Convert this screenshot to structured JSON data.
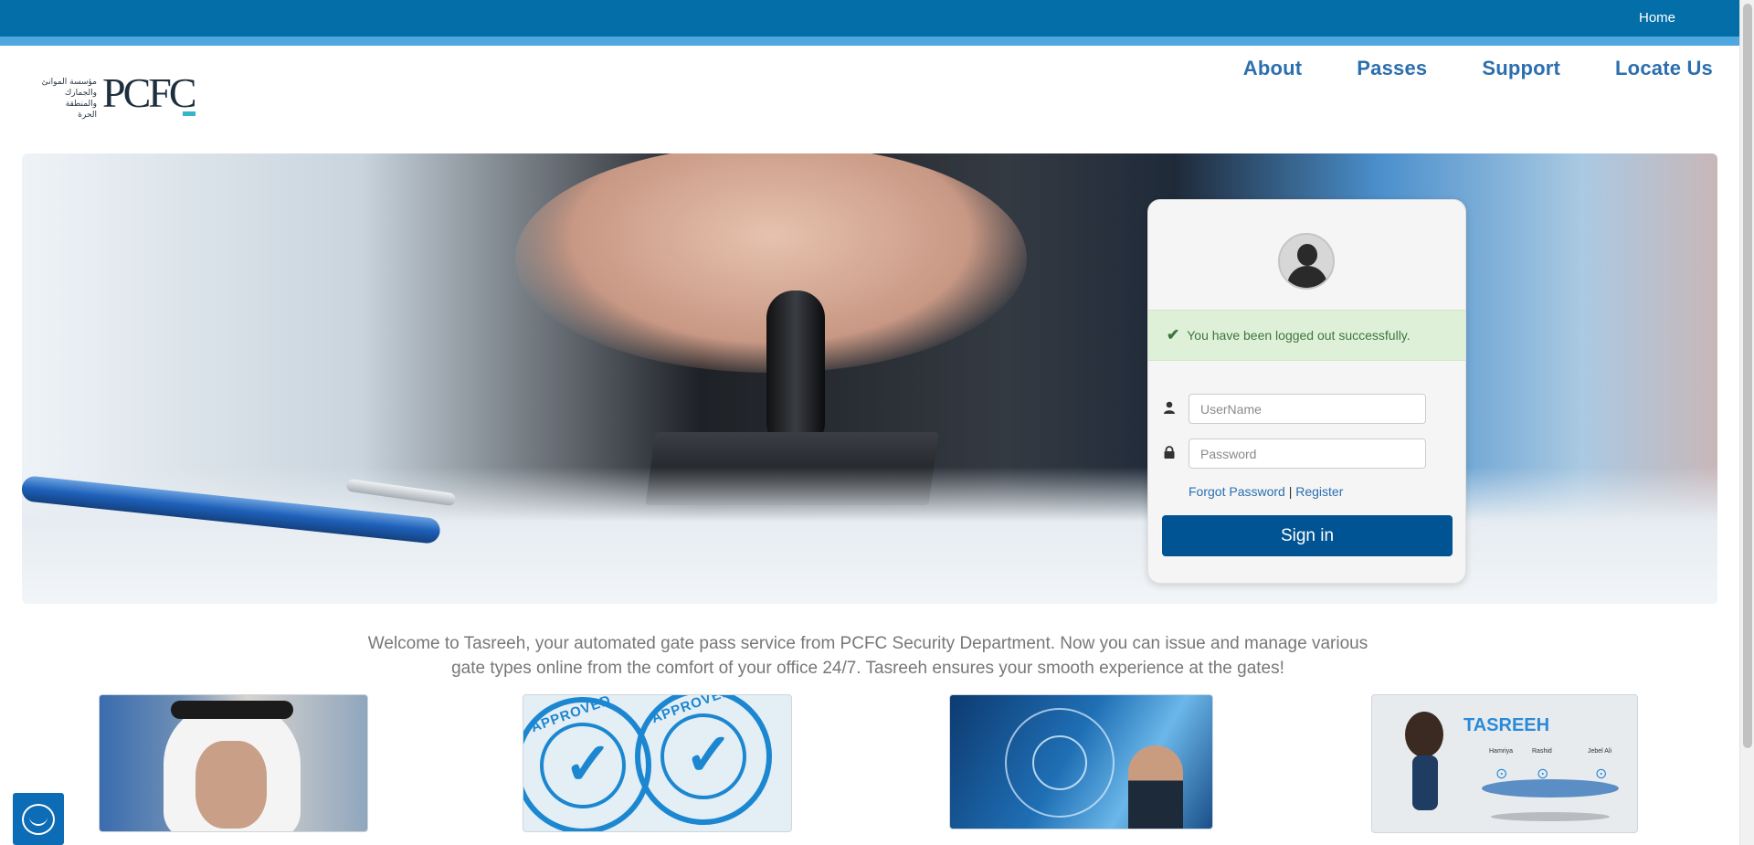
{
  "topbar": {
    "home_label": "Home"
  },
  "brand": {
    "logo_text": "PCFC",
    "logo_arabic_lines": [
      "مؤسسة الموانئ",
      "والجمارك والمنطقة",
      "الحرة"
    ]
  },
  "nav": {
    "items": [
      {
        "label": "About"
      },
      {
        "label": "Passes"
      },
      {
        "label": "Support"
      },
      {
        "label": "Locate Us"
      }
    ]
  },
  "login": {
    "alert_message": "You have been logged out successfully.",
    "username_placeholder": "UserName",
    "password_placeholder": "Password",
    "forgot_password_label": "Forgot Password",
    "separator": "|",
    "register_label": "Register",
    "signin_label": "Sign in"
  },
  "welcome": {
    "line1": "Welcome to Tasreeh, your automated gate pass service from PCFC Security Department. Now you can issue and manage various",
    "line2": "gate types online from the comfort of your office 24/7. Tasreeh ensures your smooth experience at the gates!"
  },
  "tiles": {
    "approved_word": "APPROVED",
    "tasreeh_label": "TASREEH",
    "places": [
      "Hamriya",
      "Rashid",
      "Jebel Ali"
    ]
  },
  "colors": {
    "primary": "#046ea8",
    "accent": "#4ea8df",
    "nav_link": "#2c6fae",
    "button": "#005493",
    "success_bg": "#dff0d8",
    "success_text": "#3c763d"
  }
}
